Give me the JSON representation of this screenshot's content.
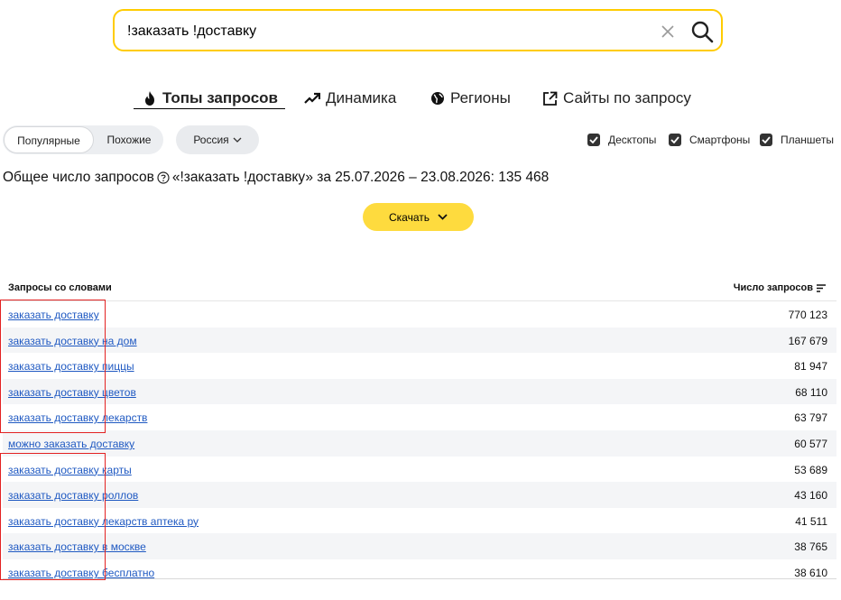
{
  "search": {
    "value": "!заказать !доставку",
    "clear_icon": "close-icon",
    "submit_icon": "search-icon"
  },
  "tabs": [
    {
      "label": "Топы запросов",
      "icon": "fire-icon",
      "active": true
    },
    {
      "label": "Динамика",
      "icon": "trend-up-icon",
      "active": false
    },
    {
      "label": "Регионы",
      "icon": "globe-icon",
      "active": false
    },
    {
      "label": "Сайты по запросу",
      "icon": "external-link-icon",
      "active": false
    }
  ],
  "filters": {
    "mode_options": [
      "Популярные",
      "Похожие"
    ],
    "mode_selected": "Популярные",
    "region": "Россия",
    "devices": [
      {
        "label": "Десктопы",
        "checked": true
      },
      {
        "label": "Смартфоны",
        "checked": true
      },
      {
        "label": "Планшеты",
        "checked": true
      }
    ]
  },
  "summary": {
    "label": "Общее число запросов",
    "text": "«!заказать !доставку» за 25.07.2026 – 23.08.2026: 135 468"
  },
  "download_label": "Скачать",
  "table": {
    "col_query": "Запросы со словами",
    "col_count": "Число запросов",
    "rows": [
      {
        "query": "заказать доставку",
        "count": "770 123"
      },
      {
        "query": "заказать доставку на дом",
        "count": "167 679"
      },
      {
        "query": "заказать доставку пиццы",
        "count": "81 947"
      },
      {
        "query": "заказать доставку цветов",
        "count": "68 110"
      },
      {
        "query": "заказать доставку лекарств",
        "count": "63 797"
      },
      {
        "query": "можно заказать доставку",
        "count": "60 577"
      },
      {
        "query": "заказать доставку карты",
        "count": "53 689"
      },
      {
        "query": "заказать доставку роллов",
        "count": "43 160"
      },
      {
        "query": "заказать доставку лекарств аптека ру",
        "count": "41 511"
      },
      {
        "query": "заказать доставку в москве",
        "count": "38 765"
      },
      {
        "query": "заказать доставку бесплатно",
        "count": "38 610"
      }
    ]
  },
  "colors": {
    "accent": "#ffcc00",
    "button": "#fedb3e",
    "link": "#1f59c2",
    "highlight": "#e32222"
  }
}
